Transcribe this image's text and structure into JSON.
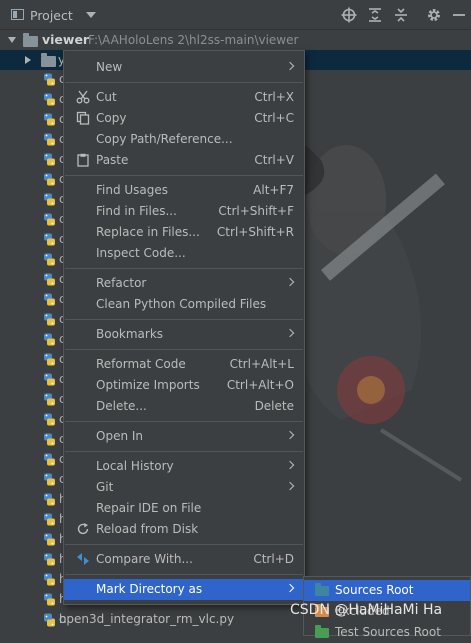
{
  "header": {
    "title": "Project",
    "icons": [
      "project-view-icon",
      "dropdown-chevron-icon",
      "locate-target-icon",
      "expand-all-icon",
      "collapse-all-icon",
      "gear-icon",
      "hide-panel-icon"
    ]
  },
  "tree": {
    "root": {
      "name": "viewer",
      "path": "F:\\AAHoloLens 2\\hl2ss-main\\viewer"
    },
    "selected_child": "y",
    "file_stubs": [
      "c",
      "c",
      "c",
      "c",
      "c",
      "c",
      "c",
      "c",
      "c",
      "c",
      "c",
      "c",
      "c",
      "c",
      "c",
      "c",
      "c",
      "c",
      "c",
      "c",
      "c",
      "h",
      "h",
      "h",
      "h",
      "h",
      "h",
      "h",
      "c",
      "c"
    ],
    "bottom_file": "open3d_integrator_rm_vlc.py"
  },
  "context_menu": {
    "items": [
      {
        "label": "New",
        "submenu": true
      },
      {
        "sep": true
      },
      {
        "label": "Cut",
        "shortcut": "Ctrl+X",
        "icon": "cut-icon"
      },
      {
        "label": "Copy",
        "shortcut": "Ctrl+C",
        "icon": "copy-icon"
      },
      {
        "label": "Copy Path/Reference..."
      },
      {
        "label": "Paste",
        "shortcut": "Ctrl+V",
        "icon": "paste-icon"
      },
      {
        "sep": true
      },
      {
        "label": "Find Usages",
        "shortcut": "Alt+F7"
      },
      {
        "label": "Find in Files...",
        "shortcut": "Ctrl+Shift+F"
      },
      {
        "label": "Replace in Files...",
        "shortcut": "Ctrl+Shift+R"
      },
      {
        "label": "Inspect Code..."
      },
      {
        "sep": true
      },
      {
        "label": "Refactor",
        "submenu": true
      },
      {
        "label": "Clean Python Compiled Files"
      },
      {
        "sep": true
      },
      {
        "label": "Bookmarks",
        "submenu": true
      },
      {
        "sep": true
      },
      {
        "label": "Reformat Code",
        "shortcut": "Ctrl+Alt+L"
      },
      {
        "label": "Optimize Imports",
        "shortcut": "Ctrl+Alt+O"
      },
      {
        "label": "Delete...",
        "shortcut": "Delete"
      },
      {
        "sep": true
      },
      {
        "label": "Open In",
        "submenu": true
      },
      {
        "sep": true
      },
      {
        "label": "Local History",
        "submenu": true
      },
      {
        "label": "Git",
        "submenu": true
      },
      {
        "label": "Repair IDE on File"
      },
      {
        "label": "Reload from Disk",
        "icon": "reload-icon"
      },
      {
        "sep": true
      },
      {
        "label": "Compare With...",
        "shortcut": "Ctrl+D",
        "icon": "compare-icon"
      },
      {
        "sep": true
      },
      {
        "label": "Mark Directory as",
        "submenu": true,
        "highlighted": true
      }
    ]
  },
  "submenu": {
    "items": [
      {
        "label": "Sources Root",
        "highlighted": true,
        "color": "#3e86a0"
      },
      {
        "label": "Excluded",
        "color": "#d38c4a"
      },
      {
        "label": "Test Sources Root",
        "color": "#499c54"
      }
    ]
  },
  "watermark": "CSDN @HaMiHaMi Ha",
  "colors": {
    "background": "#3c3f41",
    "selection": "#0d293e",
    "highlight": "#2f65ca",
    "text": "#bbbbbb"
  }
}
